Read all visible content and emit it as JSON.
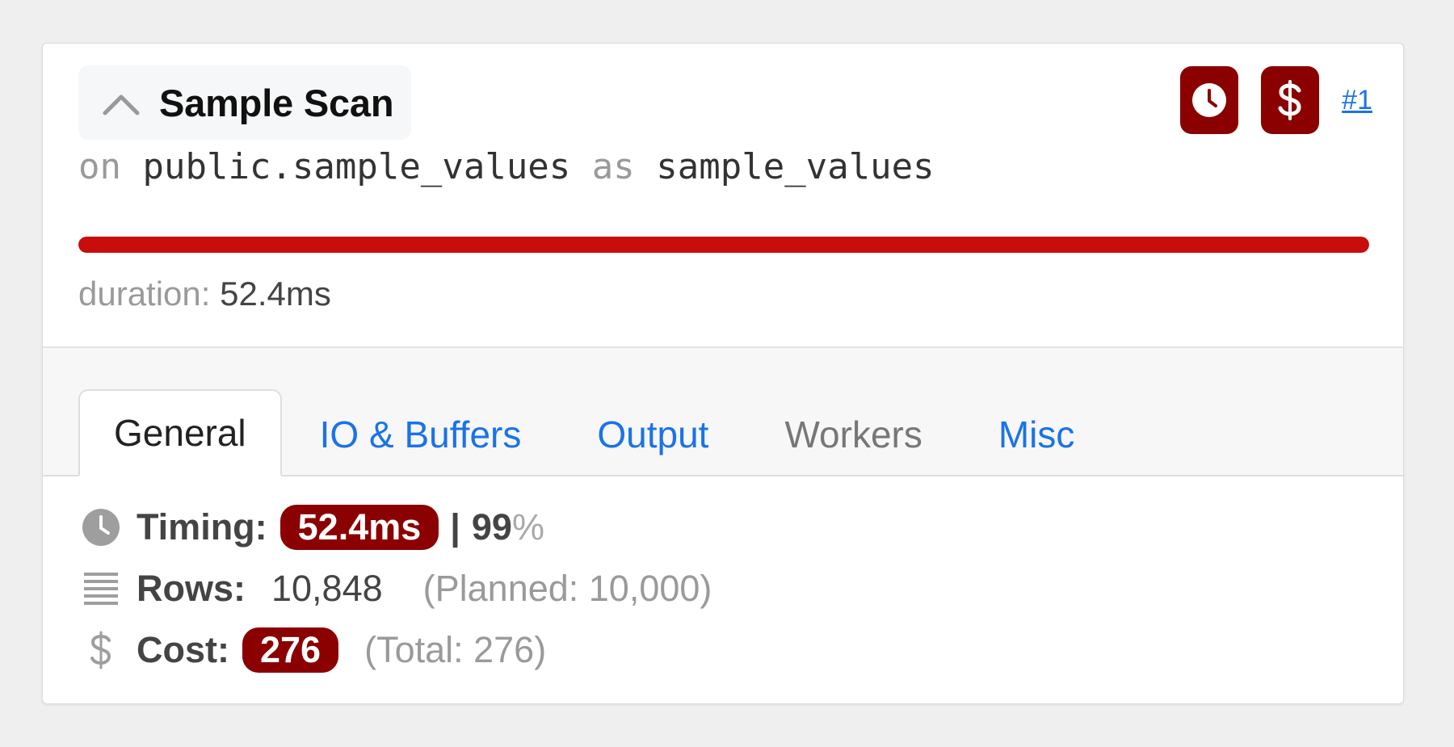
{
  "node": {
    "title": "Sample Scan",
    "link": "#1",
    "relation": {
      "on_kw": "on",
      "table": "public.sample_values",
      "as_kw": "as",
      "alias": "sample_values"
    },
    "progress_fraction": 1.0,
    "progress_color": "#c80d0d",
    "duration_label": "duration:",
    "duration_value": "52.4ms",
    "badges": [
      {
        "name": "clock-icon",
        "color": "#8b0000"
      },
      {
        "name": "dollar-icon",
        "color": "#8b0000"
      }
    ]
  },
  "tabs": [
    {
      "label": "General",
      "state": "active"
    },
    {
      "label": "IO & Buffers",
      "state": "link"
    },
    {
      "label": "Output",
      "state": "link"
    },
    {
      "label": "Workers",
      "state": "disabled"
    },
    {
      "label": "Misc",
      "state": "link"
    }
  ],
  "general": {
    "timing": {
      "label": "Timing:",
      "value": "52.4ms",
      "sep": "|",
      "percent": "99",
      "percent_sym": "%"
    },
    "rows": {
      "label": "Rows:",
      "value": "10,848",
      "planned": "(Planned: 10,000)"
    },
    "cost": {
      "label": "Cost:",
      "value": "276",
      "total": "(Total: 276)"
    }
  },
  "colors": {
    "accent_dark_red": "#8b0000",
    "link_blue": "#1a73e8"
  }
}
